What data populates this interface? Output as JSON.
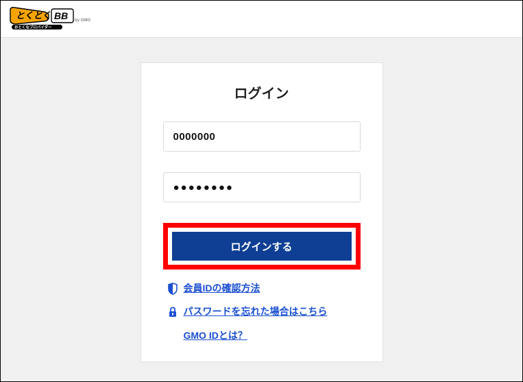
{
  "header": {
    "logo_main": "とくとく",
    "logo_bb": "BB",
    "logo_tagline": "おとくなプロバイダー",
    "logo_suffix": "by GMO"
  },
  "login": {
    "title": "ログイン",
    "id_value": "0000000",
    "password_mask": "●●●●●●●●",
    "submit_label": "ログインする"
  },
  "links": {
    "confirm_id": "会員IDの確認方法",
    "forgot_password": "パスワードを忘れた場合はこちら",
    "gmo_id": "GMO IDとは？"
  }
}
